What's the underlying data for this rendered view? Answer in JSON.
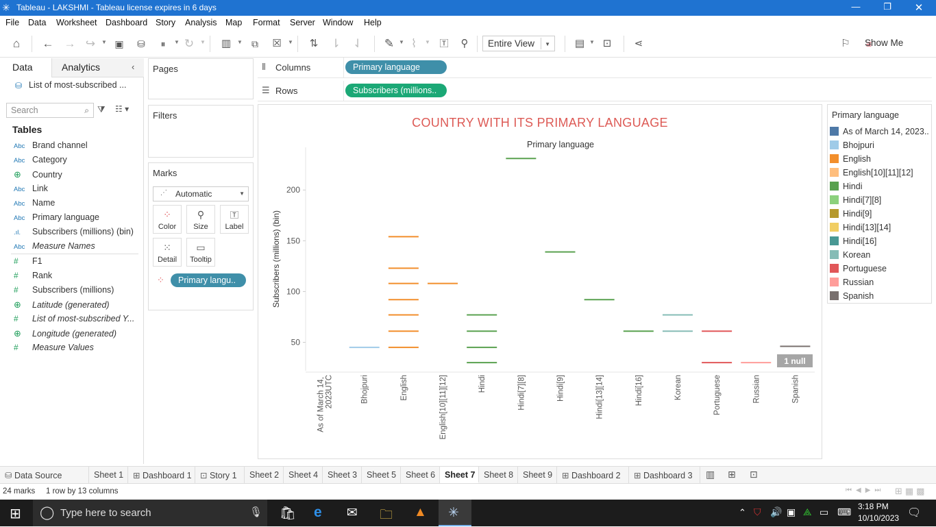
{
  "window": {
    "title": "Tableau - LAKSHMI - Tableau license expires in 6 days"
  },
  "menu": [
    "File",
    "Data",
    "Worksheet",
    "Dashboard",
    "Story",
    "Analysis",
    "Map",
    "Format",
    "Server",
    "Window",
    "Help"
  ],
  "toolbar": {
    "view_mode": "Entire View",
    "show_me": "Show Me"
  },
  "left_pane": {
    "tabs": [
      "Data",
      "Analytics"
    ],
    "datasource": "List of most-subscribed ...",
    "search_placeholder": "Search",
    "tables_heading": "Tables",
    "dimensions": [
      {
        "type": "Abc",
        "name": "Brand channel",
        "italic": false
      },
      {
        "type": "Abc",
        "name": "Category",
        "italic": false
      },
      {
        "type": "globe",
        "name": "Country",
        "italic": false
      },
      {
        "type": "Abc",
        "name": "Link",
        "italic": false
      },
      {
        "type": "Abc",
        "name": "Name",
        "italic": false
      },
      {
        "type": "Abc",
        "name": "Primary language",
        "italic": false
      },
      {
        "type": "bin",
        "name": "Subscribers (millions) (bin)",
        "italic": false
      },
      {
        "type": "Abc",
        "name": "Measure Names",
        "italic": true
      }
    ],
    "measures": [
      {
        "type": "#",
        "name": "F1",
        "italic": false
      },
      {
        "type": "#",
        "name": "Rank",
        "italic": false
      },
      {
        "type": "#",
        "name": "Subscribers (millions)",
        "italic": false
      },
      {
        "type": "globe",
        "name": "Latitude (generated)",
        "italic": true
      },
      {
        "type": "#",
        "name": "List of most-subscribed Y...",
        "italic": true
      },
      {
        "type": "globe",
        "name": "Longitude (generated)",
        "italic": true
      },
      {
        "type": "#",
        "name": "Measure Values",
        "italic": true
      }
    ]
  },
  "cards": {
    "pages": "Pages",
    "filters": "Filters",
    "marks": "Marks",
    "mark_type": "Automatic",
    "mark_buttons": [
      "Color",
      "Size",
      "Label",
      "Detail",
      "Tooltip"
    ],
    "color_pill": "Primary langu.."
  },
  "shelves": {
    "columns_label": "Columns",
    "columns_pill": "Primary language",
    "rows_label": "Rows",
    "rows_pill": "Subscribers (millions.."
  },
  "chart_data": {
    "type": "scatter",
    "mark": "horizontal dash",
    "title": "COUNTRY WITH ITS PRIMARY LANGUAGE",
    "column_header": "Primary language",
    "ylabel": "Subscribers (millions) (bin)",
    "ylim": [
      22,
      242
    ],
    "yticks": [
      50,
      100,
      150,
      200
    ],
    "categories": [
      "As of March 14, 2023UTC",
      "Bhojpuri",
      "English",
      "English[10][11][12]",
      "Hindi",
      "Hindi[7][8]",
      "Hindi[9]",
      "Hindi[13][14]",
      "Hindi[16]",
      "Korean",
      "Portuguese",
      "Russian",
      "Spanish"
    ],
    "points": [
      {
        "category": "Bhojpuri",
        "values": [
          45
        ]
      },
      {
        "category": "English",
        "values": [
          45,
          61,
          77,
          92,
          108,
          123,
          154
        ]
      },
      {
        "category": "English[10][11][12]",
        "values": [
          108
        ]
      },
      {
        "category": "Hindi",
        "values": [
          30,
          45,
          61,
          77
        ]
      },
      {
        "category": "Hindi[7][8]",
        "values": [
          231
        ]
      },
      {
        "category": "Hindi[9]",
        "values": [
          139
        ]
      },
      {
        "category": "Hindi[13][14]",
        "values": [
          92
        ]
      },
      {
        "category": "Hindi[16]",
        "values": [
          61
        ]
      },
      {
        "category": "Korean",
        "values": [
          61,
          77
        ]
      },
      {
        "category": "Portuguese",
        "values": [
          30,
          61
        ]
      },
      {
        "category": "Russian",
        "values": [
          30
        ]
      },
      {
        "category": "Spanish",
        "values": [
          46
        ]
      }
    ],
    "null_indicator": "1 null"
  },
  "legend": {
    "title": "Primary language",
    "items": [
      {
        "label": "As of March 14, 2023..",
        "color": "#4e79a7"
      },
      {
        "label": "Bhojpuri",
        "color": "#a0cbe8"
      },
      {
        "label": "English",
        "color": "#f28e2b"
      },
      {
        "label": "English[10][11][12]",
        "color": "#ffbe7d"
      },
      {
        "label": "Hindi",
        "color": "#59a14f"
      },
      {
        "label": "Hindi[7][8]",
        "color": "#8cd17d"
      },
      {
        "label": "Hindi[9]",
        "color": "#b6992d"
      },
      {
        "label": "Hindi[13][14]",
        "color": "#f1ce63"
      },
      {
        "label": "Hindi[16]",
        "color": "#499894"
      },
      {
        "label": "Korean",
        "color": "#86bcb6"
      },
      {
        "label": "Portuguese",
        "color": "#e15759"
      },
      {
        "label": "Russian",
        "color": "#ff9d9a"
      },
      {
        "label": "Spanish",
        "color": "#79706e"
      }
    ]
  },
  "sheet_tabs": [
    {
      "label": "Data Source",
      "icon": "database-icon",
      "selected": false
    },
    {
      "label": "Sheet 1",
      "icon": "",
      "selected": false
    },
    {
      "label": "Dashboard 1",
      "icon": "dashboard-icon",
      "selected": false
    },
    {
      "label": "Story 1",
      "icon": "story-icon",
      "selected": false
    },
    {
      "label": "Sheet 2",
      "icon": "",
      "selected": false
    },
    {
      "label": "Sheet 4",
      "icon": "",
      "selected": false
    },
    {
      "label": "Sheet 3",
      "icon": "",
      "selected": false
    },
    {
      "label": "Sheet 5",
      "icon": "",
      "selected": false
    },
    {
      "label": "Sheet 6",
      "icon": "",
      "selected": false
    },
    {
      "label": "Sheet 7",
      "icon": "",
      "selected": true
    },
    {
      "label": "Sheet 8",
      "icon": "",
      "selected": false
    },
    {
      "label": "Sheet 9",
      "icon": "",
      "selected": false
    },
    {
      "label": "Dashboard 2",
      "icon": "dashboard-icon",
      "selected": false
    },
    {
      "label": "Dashboard 3",
      "icon": "dashboard-icon",
      "selected": false
    }
  ],
  "status": {
    "marks": "24 marks",
    "dims": "1 row by 13 columns"
  },
  "taskbar": {
    "search_placeholder": "Type here to search",
    "time": "3:18 PM",
    "date": "10/10/2023"
  }
}
